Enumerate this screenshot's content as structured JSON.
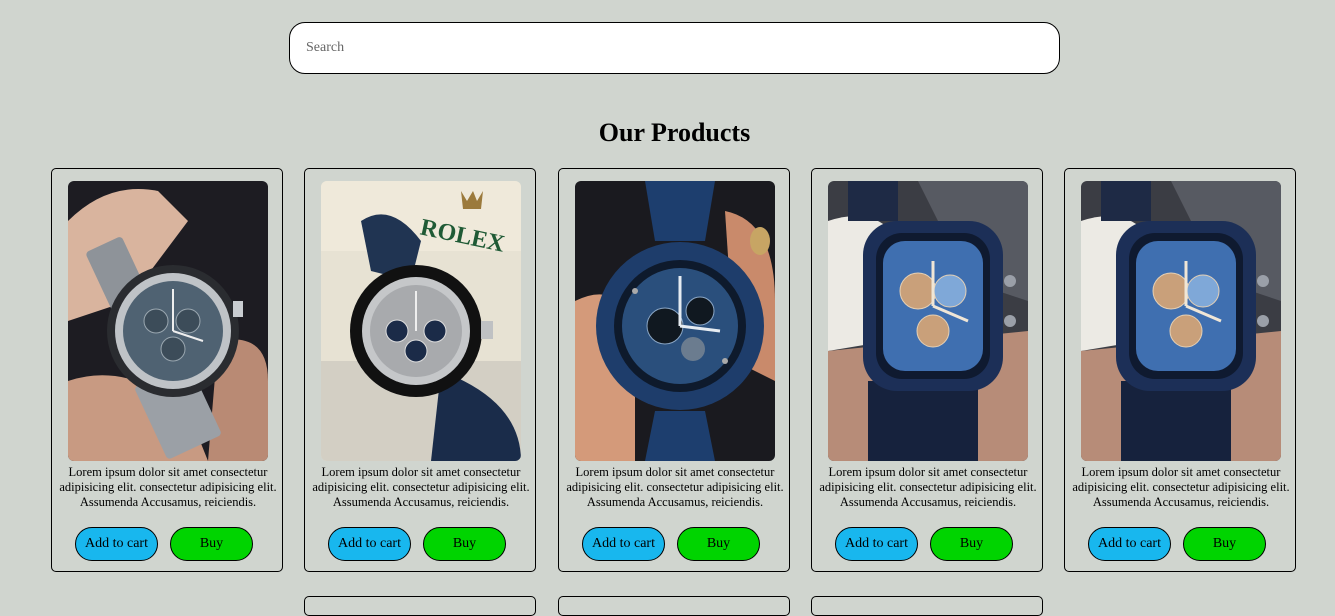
{
  "search": {
    "placeholder": "Search",
    "value": ""
  },
  "section": {
    "title": "Our Products"
  },
  "products": [
    {
      "image": "silver-chronograph-watch-photo",
      "description": "Lorem ipsum dolor sit amet consectetur adipisicing elit. consectetur adipisicing elit. Assumenda Accusamus, reiciendis.",
      "cart_label": "Add to cart",
      "buy_label": "Buy"
    },
    {
      "image": "rolex-daytona-watch-photo",
      "description": "Lorem ipsum dolor sit amet consectetur adipisicing elit. consectetur adipisicing elit. Assumenda Accusamus, reiciendis.",
      "cart_label": "Add to cart",
      "buy_label": "Buy"
    },
    {
      "image": "blue-skeleton-watch-photo",
      "description": "Lorem ipsum dolor sit amet consectetur adipisicing elit. consectetur adipisicing elit. Assumenda Accusamus, reiciendis.",
      "cart_label": "Add to cart",
      "buy_label": "Buy"
    },
    {
      "image": "tonneau-skeleton-watch-on-wrist-photo",
      "description": "Lorem ipsum dolor sit amet consectetur adipisicing elit. consectetur adipisicing elit. Assumenda Accusamus, reiciendis.",
      "cart_label": "Add to cart",
      "buy_label": "Buy"
    },
    {
      "image": "tonneau-skeleton-watch-on-wrist-photo",
      "description": "Lorem ipsum dolor sit amet consectetur adipisicing elit. consectetur adipisicing elit. Assumenda Accusamus, reiciendis.",
      "cart_label": "Add to cart",
      "buy_label": "Buy"
    }
  ],
  "colors": {
    "page_background": "#d0d5cf",
    "add_to_cart": "#18b7ee",
    "buy": "#00d400"
  }
}
